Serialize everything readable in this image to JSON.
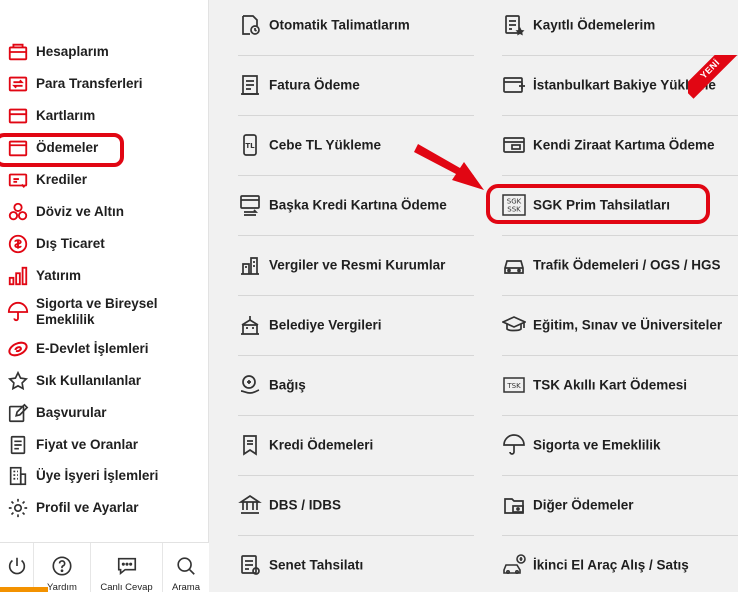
{
  "sidebar": {
    "items": [
      {
        "label": "Hesaplarım",
        "icon": "wallet-icon"
      },
      {
        "label": "Para Transferleri",
        "icon": "transfer-icon"
      },
      {
        "label": "Kartlarım",
        "icon": "card-icon"
      },
      {
        "label": "Ödemeler",
        "icon": "payments-icon",
        "active": true
      },
      {
        "label": "Krediler",
        "icon": "loan-icon"
      },
      {
        "label": "Döviz ve Altın",
        "icon": "coins-icon"
      },
      {
        "label": "Dış Ticaret",
        "icon": "globe-money-icon"
      },
      {
        "label": "Yatırım",
        "icon": "bar-chart-icon"
      },
      {
        "label": "Sigorta ve Bireysel Emeklilik",
        "icon": "umbrella-icon"
      },
      {
        "label": "E-Devlet İşlemleri",
        "icon": "edevlet-icon"
      },
      {
        "label": "Sık Kullanılanlar",
        "icon": "star-icon"
      },
      {
        "label": "Başvurular",
        "icon": "edit-icon"
      },
      {
        "label": "Fiyat ve Oranlar",
        "icon": "document-icon"
      },
      {
        "label": "Üye İşyeri İşlemleri",
        "icon": "building-icon"
      },
      {
        "label": "Profil ve Ayarlar",
        "icon": "gear-icon"
      }
    ]
  },
  "bottom_bar": {
    "items": [
      {
        "label": "",
        "icon": "power-icon"
      },
      {
        "label": "Yardım",
        "icon": "help-icon"
      },
      {
        "label": "Canlı Cevap",
        "icon": "chat-icon"
      },
      {
        "label": "Arama",
        "icon": "search-icon"
      }
    ]
  },
  "menu": {
    "left": [
      {
        "label": "Otomatik Talimatlarım",
        "icon": "auto-instruction-icon"
      },
      {
        "label": "Fatura Ödeme",
        "icon": "invoice-icon"
      },
      {
        "label": "Cebe TL Yükleme",
        "icon": "phone-tl-icon"
      },
      {
        "label": "Başka Kredi Kartına Ödeme",
        "icon": "card-transfer-icon"
      },
      {
        "label": "Vergiler ve Resmi Kurumlar",
        "icon": "tax-building-icon"
      },
      {
        "label": "Belediye Vergileri",
        "icon": "municipality-icon"
      },
      {
        "label": "Bağış",
        "icon": "donation-icon"
      },
      {
        "label": "Kredi Ödemeleri",
        "icon": "loan-payment-icon"
      },
      {
        "label": "DBS / IDBS",
        "icon": "dbs-icon"
      },
      {
        "label": "Senet Tahsilatı",
        "icon": "bond-icon"
      }
    ],
    "right": [
      {
        "label": "Kayıtlı Ödemelerim",
        "icon": "saved-payments-icon"
      },
      {
        "label": "İstanbulkart Bakiye Yükleme",
        "icon": "istanbulkart-icon"
      },
      {
        "label": "Kendi Ziraat Kartıma Ödeme",
        "icon": "own-card-icon"
      },
      {
        "label": "SGK Prim Tahsilatları",
        "icon": "sgk-icon"
      },
      {
        "label": "Trafik Ödemeleri / OGS / HGS",
        "icon": "car-icon"
      },
      {
        "label": "Eğitim, Sınav ve Üniversiteler",
        "icon": "graduation-cap-icon"
      },
      {
        "label": "TSK Akıllı Kart Ödemesi",
        "icon": "tsk-card-icon"
      },
      {
        "label": "Sigorta ve Emeklilik",
        "icon": "umbrella-icon"
      },
      {
        "label": "Diğer Ödemeler",
        "icon": "other-payments-icon"
      },
      {
        "label": "İkinci El Araç Alış / Satış",
        "icon": "second-hand-car-icon"
      }
    ]
  },
  "badge": {
    "new_label": "YENİ"
  },
  "icon_texts": {
    "sgk_line1": "SGK",
    "sgk_line2": "SSK",
    "tsk": "TSK",
    "tl": "TL"
  },
  "colors": {
    "accent": "#e10613",
    "icon": "#333333",
    "bottom_strip": "#f39200"
  }
}
